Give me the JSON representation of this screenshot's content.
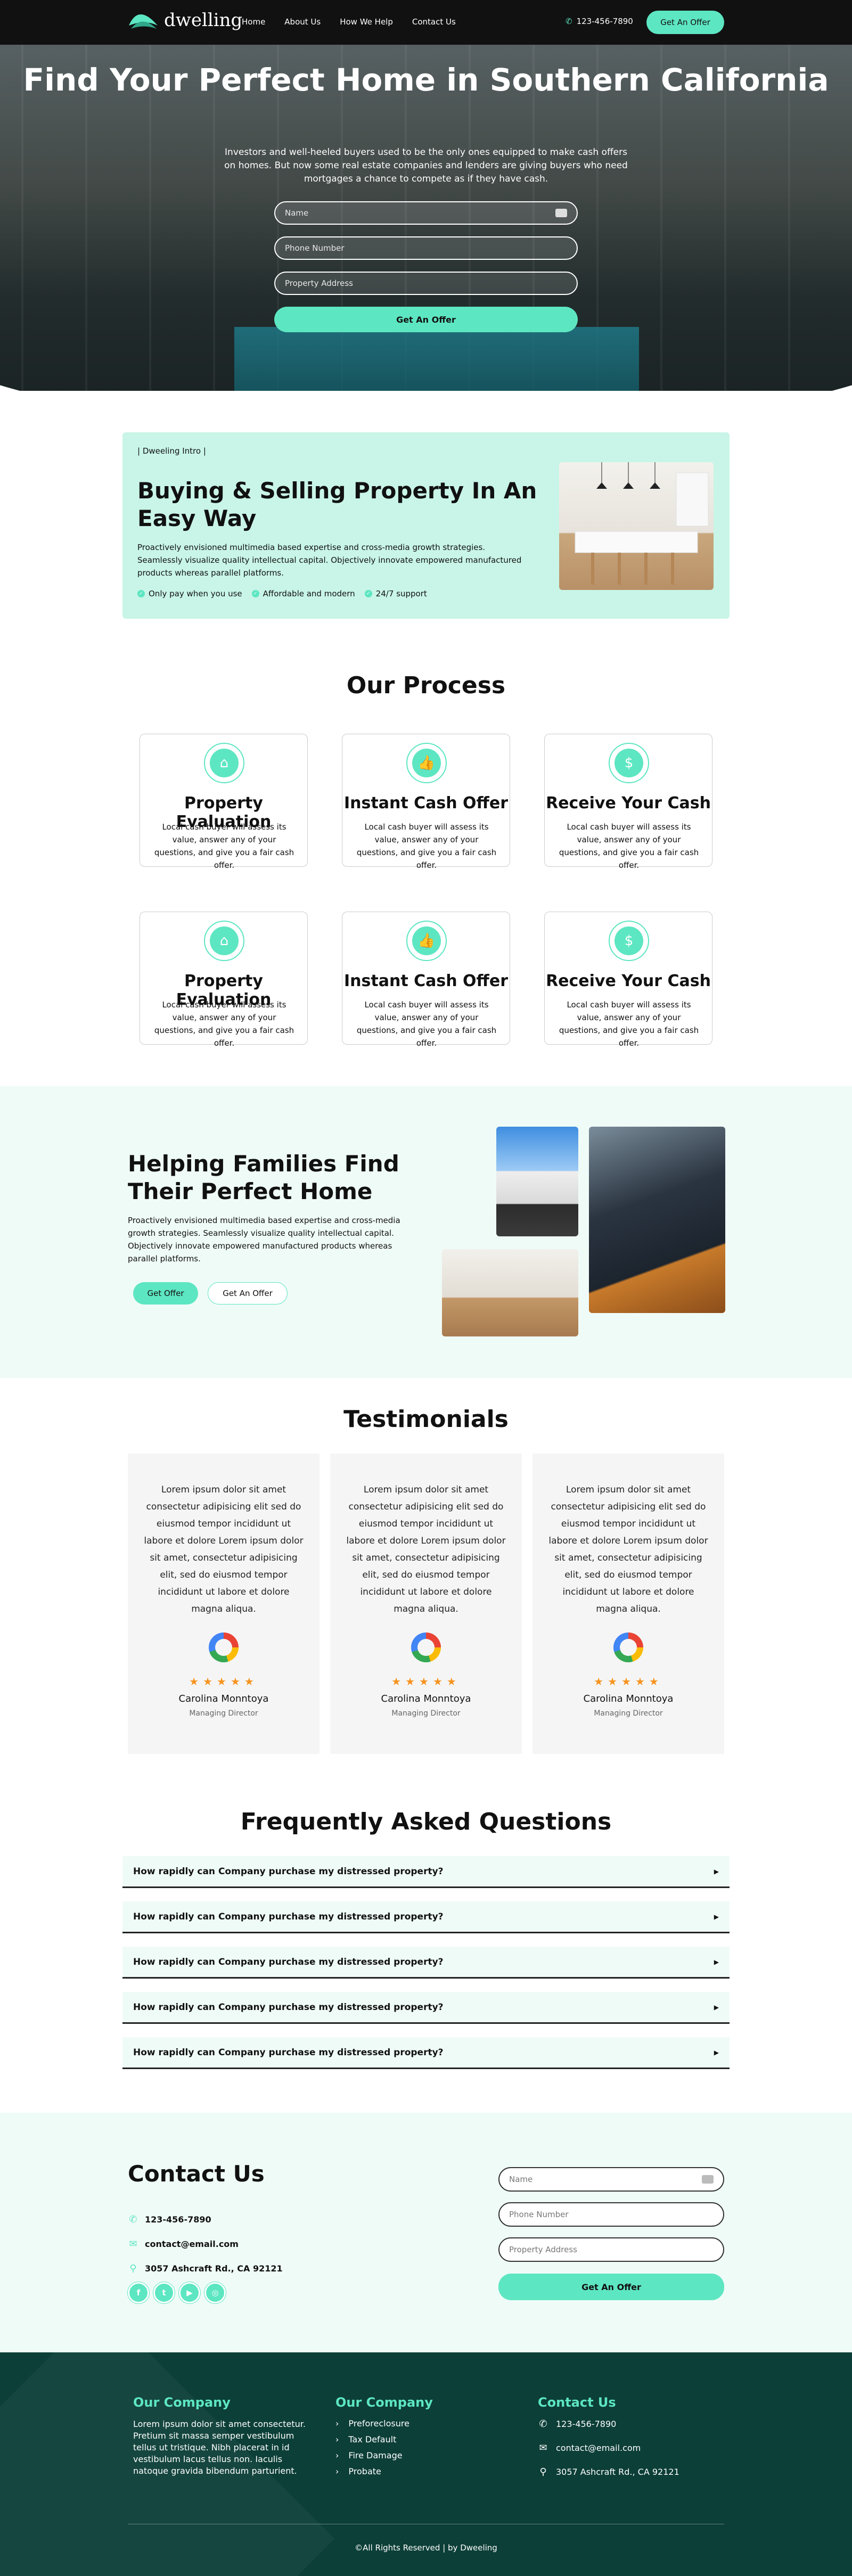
{
  "brand": {
    "name": "dwelling",
    "accent": "#5de6c2",
    "dark": "#111111",
    "footer_bg": "#0c3f38"
  },
  "nav": {
    "links": [
      "Home",
      "About Us",
      "How We Help",
      "Contact Us"
    ],
    "phone": "123-456-7890",
    "cta": "Get An Offer"
  },
  "hero": {
    "title": "Find Your Perfect Home in Southern California",
    "subtitle": "Investors and well-heeled buyers used to be the only ones equipped to make cash offers on homes. But now some real estate companies and lenders are giving buyers who need mortgages a chance to compete as if they have cash.",
    "fields": {
      "name": "Name",
      "phone": "Phone Number",
      "address": "Property Address"
    },
    "submit": "Get An Offer"
  },
  "intro": {
    "tag": "|  Dweeling Intro  |",
    "title": "Buying & Selling Property In An Easy Way",
    "text": "Proactively envisioned multimedia based expertise and cross-media growth strategies. Seamlessly visualize quality intellectual capital. Objectively innovate empowered manufactured products whereas parallel platforms.",
    "checks": [
      "Only pay when you use",
      "Affordable and modern",
      "24/7 support"
    ]
  },
  "process": {
    "title": "Our Process",
    "cards": [
      {
        "icon": "home-icon",
        "title": "Property Evaluation",
        "text": "Local cash buyer will assess its value, answer any of your questions, and give you a fair cash offer."
      },
      {
        "icon": "thumbs-up-icon",
        "title": "Instant Cash Offer",
        "text": "Local cash buyer will assess its value, answer any of your questions, and give you a fair cash offer."
      },
      {
        "icon": "cash-icon",
        "title": "Receive Your Cash",
        "text": "Local cash buyer will assess its value, answer any of your questions, and give you a fair cash offer."
      },
      {
        "icon": "home-icon",
        "title": "Property Evaluation",
        "text": "Local cash buyer will assess its value, answer any of your questions, and give you a fair cash offer."
      },
      {
        "icon": "thumbs-up-icon",
        "title": "Instant Cash Offer",
        "text": "Local cash buyer will assess its value, answer any of your questions, and give you a fair cash offer."
      },
      {
        "icon": "cash-icon",
        "title": "Receive Your Cash",
        "text": "Local cash buyer will assess its value, answer any of your questions, and give you a fair cash offer."
      }
    ]
  },
  "helping": {
    "title": "Helping Families Find Their Perfect Home",
    "text": "Proactively envisioned multimedia based expertise and cross-media growth strategies. Seamlessly visualize quality intellectual capital. Objectively innovate empowered manufactured products whereas parallel platforms.",
    "btn_primary": "Get Offer",
    "btn_secondary": "Get An Offer"
  },
  "testimonials": {
    "title": "Testimonials",
    "items": [
      {
        "text": "Lorem ipsum dolor sit amet consectetur adipisicing elit sed do eiusmod tempor incididunt ut labore et dolore Lorem ipsum dolor sit amet, consectetur adipisicing elit, sed do eiusmod tempor incididunt ut labore et dolore magna aliqua.",
        "stars": "★★★★★",
        "name": "Carolina Monntoya",
        "role": "Managing Director"
      },
      {
        "text": "Lorem ipsum dolor sit amet consectetur adipisicing elit sed do eiusmod tempor incididunt ut labore et dolore Lorem ipsum dolor sit amet, consectetur adipisicing elit, sed do eiusmod tempor incididunt ut labore et dolore magna aliqua.",
        "stars": "★★★★★",
        "name": "Carolina Monntoya",
        "role": "Managing Director"
      },
      {
        "text": "Lorem ipsum dolor sit amet consectetur adipisicing elit sed do eiusmod tempor incididunt ut labore et dolore Lorem ipsum dolor sit amet, consectetur adipisicing elit, sed do eiusmod tempor incididunt ut labore et dolore magna aliqua.",
        "stars": "★★★★★",
        "name": "Carolina Monntoya",
        "role": "Managing Director"
      }
    ]
  },
  "faq": {
    "title": "Frequently Asked Questions",
    "items": [
      "How rapidly can Company purchase my distressed property?",
      "How rapidly can Company purchase my distressed property?",
      "How rapidly can Company purchase my distressed property?",
      "How rapidly can Company purchase my distressed property?",
      "How rapidly can Company purchase my distressed property?"
    ]
  },
  "contact": {
    "title": "Contact Us",
    "phone": "123-456-7890",
    "email": "contact@email.com",
    "address": "3057 Ashcraft Rd., CA 92121",
    "form": {
      "name": "Name",
      "phone": "Phone Number",
      "address": "Property Address",
      "submit": "Get An Offer"
    }
  },
  "footer": {
    "col1_title": "Our Company",
    "col1_text": "Lorem ipsum dolor sit amet consectetur. Pretium sit massa semper vestibulum tellus ut tristique. Nibh placerat in id vestibulum lacus tellus non. Iaculis natoque gravida bibendum parturient.",
    "col2_title": "Our Company",
    "col2_links": [
      "Preforeclosure",
      "Tax Default",
      "Fire Damage",
      "Probate"
    ],
    "col3_title": "Contact Us",
    "phone": "123-456-7890",
    "email": "contact@email.com",
    "address": "3057 Ashcraft Rd., CA 92121",
    "copyright": "©All Rights Reserved | by Dweeling"
  }
}
